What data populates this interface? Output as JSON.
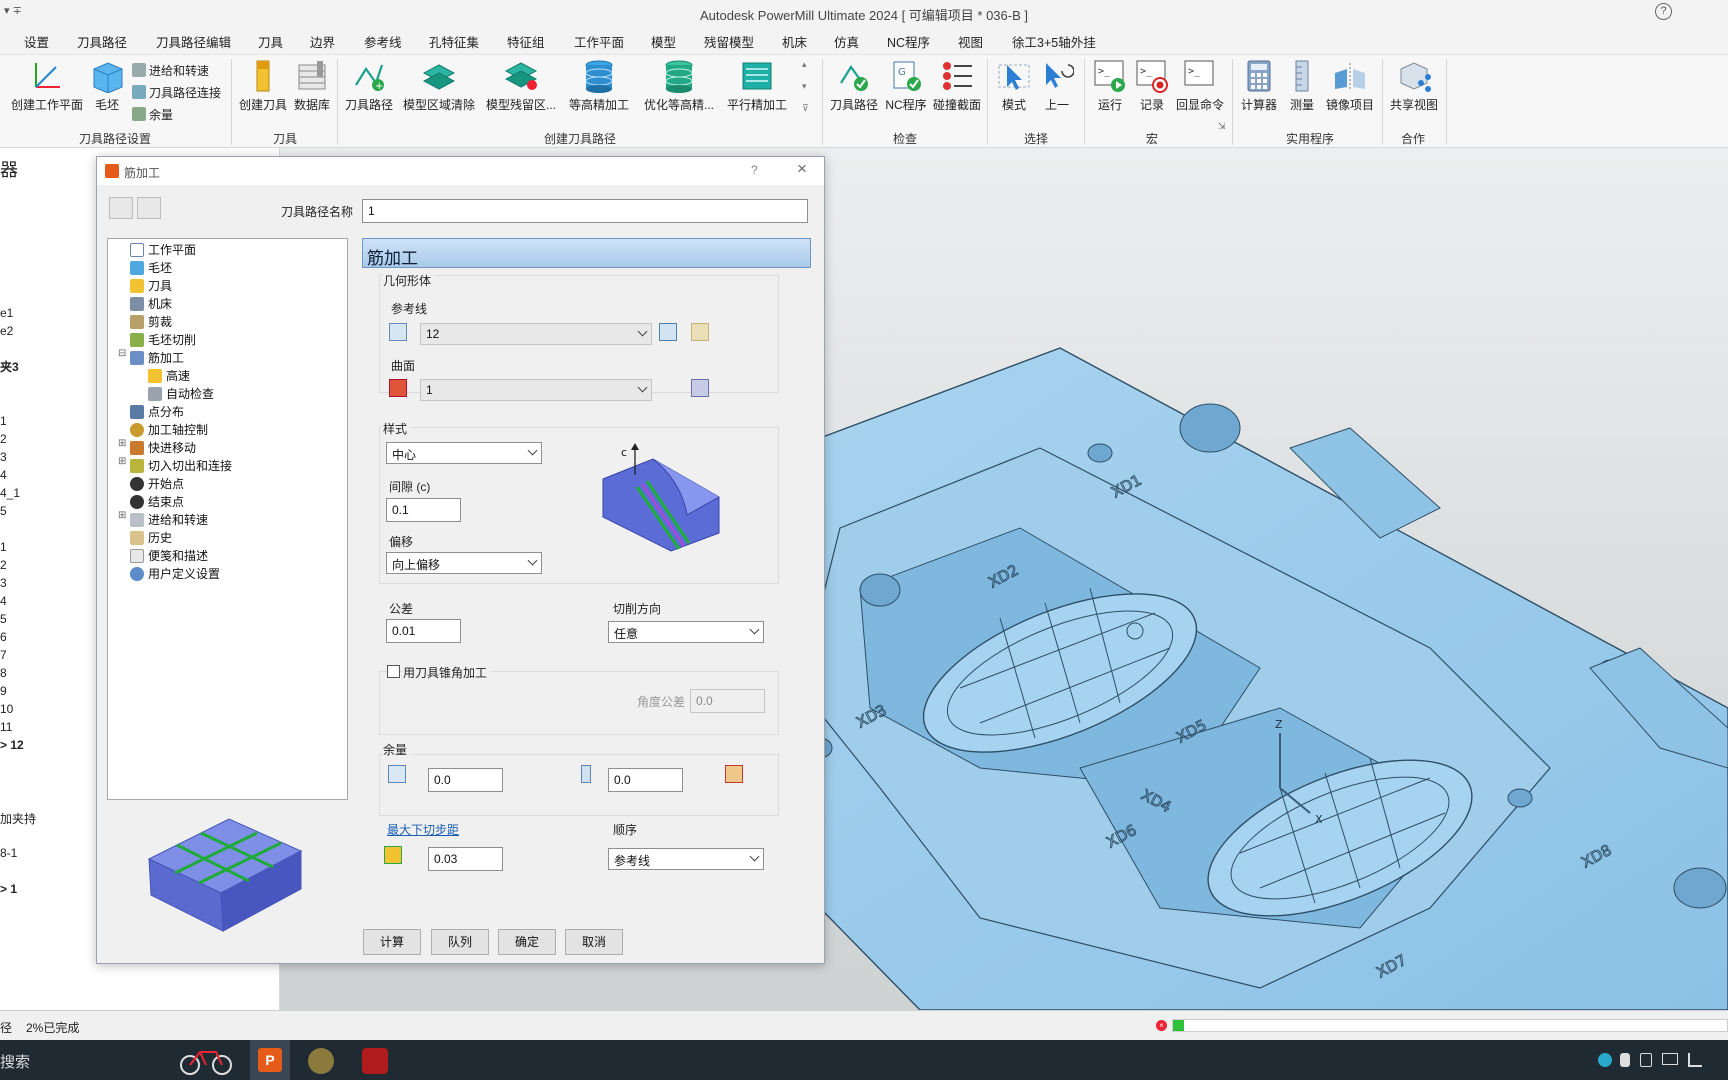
{
  "window": {
    "title": "Autodesk PowerMill Ultimate 2024    [ 可编辑项目 * 036-B ]",
    "quick_access": "▾ ∓",
    "help": "?"
  },
  "tabs": [
    "设置",
    "刀具路径",
    "刀具路径编辑",
    "刀具",
    "边界",
    "参考线",
    "孔特征集",
    "特征组",
    "工作平面",
    "模型",
    "残留模型",
    "机床",
    "仿真",
    "NC程序",
    "视图",
    "徐工3+5轴外挂"
  ],
  "ribbon": {
    "toolpath_setup": {
      "create_workplane": "创建工作平面",
      "block": "毛坯",
      "feeds_speeds": "进给和转速",
      "toolpath_connect": "刀具路径连接",
      "thickness": "余量",
      "group": "刀具路径设置"
    },
    "tool": {
      "create_tool": "创建刀具",
      "database": "数据库",
      "group": "刀具"
    },
    "create_toolpath": {
      "toolpath": "刀具路径",
      "model_area_clearance": "模型区域清除",
      "model_rest_area": "模型残留区...",
      "constant_z_finishing": "等高精加工",
      "optimized_constant_z": "优化等高精...",
      "raster_finishing": "平行精加工",
      "group": "创建刀具路径"
    },
    "check": {
      "toolpath": "刀具路径",
      "nc_program": "NC程序",
      "collision_section": "碰撞截面",
      "group": "检查"
    },
    "select": {
      "mode": "模式",
      "previous": "上一",
      "group": "选择"
    },
    "macro": {
      "run": "运行",
      "record": "记录",
      "echo": "回显命令",
      "group": "宏"
    },
    "utilities": {
      "calculator": "计算器",
      "measure": "测量",
      "mirror": "镜像项目",
      "group": "实用程序"
    },
    "collaborate": {
      "shared_view": "共享视图",
      "group": "合作"
    }
  },
  "explorer": {
    "items": [
      "器",
      "e1",
      "e2",
      "夹3",
      "1",
      "2",
      "3",
      "4",
      "4_1",
      "5",
      "1",
      "2",
      "3",
      "4",
      "5",
      "6",
      "7",
      "8",
      "9",
      "10",
      "11",
      "> 12",
      "加夹持",
      "8-1",
      "> 1"
    ]
  },
  "dialog": {
    "title": "筋加工",
    "help": "?",
    "toolpath_name_label": "刀具路径名称",
    "toolpath_name_value": "1",
    "header": "筋加工",
    "tree": [
      "工作平面",
      "毛坯",
      "刀具",
      "机床",
      "剪裁",
      "毛坯切削",
      "筋加工",
      "高速",
      "自动检查",
      "点分布",
      "加工轴控制",
      "快进移动",
      "切入切出和连接",
      "开始点",
      "结束点",
      "进给和转速",
      "历史",
      "便笺和描述",
      "用户定义设置"
    ],
    "geometry": {
      "group": "几何形体",
      "pattern_label": "参考线",
      "pattern_value": "12",
      "surface_label": "曲面",
      "surface_value": "1"
    },
    "style": {
      "group": "样式",
      "style_value": "中心",
      "gap_label": "间隙 (c)",
      "gap_value": "0.1",
      "offset_label": "偏移",
      "offset_value": "向上偏移",
      "diagram_label": "c"
    },
    "tolerance_label": "公差",
    "tolerance_value": "0.01",
    "cut_direction_label": "切削方向",
    "cut_direction_value": "任意",
    "taper_label": "用刀具锥角加工",
    "angle_tol_label": "角度公差",
    "angle_tol_value": "0.0",
    "thickness": {
      "group": "余量",
      "radial": "0.0",
      "axial": "0.0"
    },
    "stepdown_link": "最大下切步距",
    "stepdown_value": "0.03",
    "order_label": "顺序",
    "order_value": "参考线",
    "buttons": {
      "calculate": "计算",
      "queue": "队列",
      "ok": "确定",
      "cancel": "取消"
    }
  },
  "viewport": {
    "labels": [
      "XD1",
      "XD2",
      "XD3",
      "XD4",
      "XD5",
      "XD6",
      "XD7",
      "XD8"
    ],
    "axis_z": "Z",
    "axis_x": "X"
  },
  "status": {
    "left": "径",
    "progress_text": "2%已完成",
    "search": "搜索"
  }
}
